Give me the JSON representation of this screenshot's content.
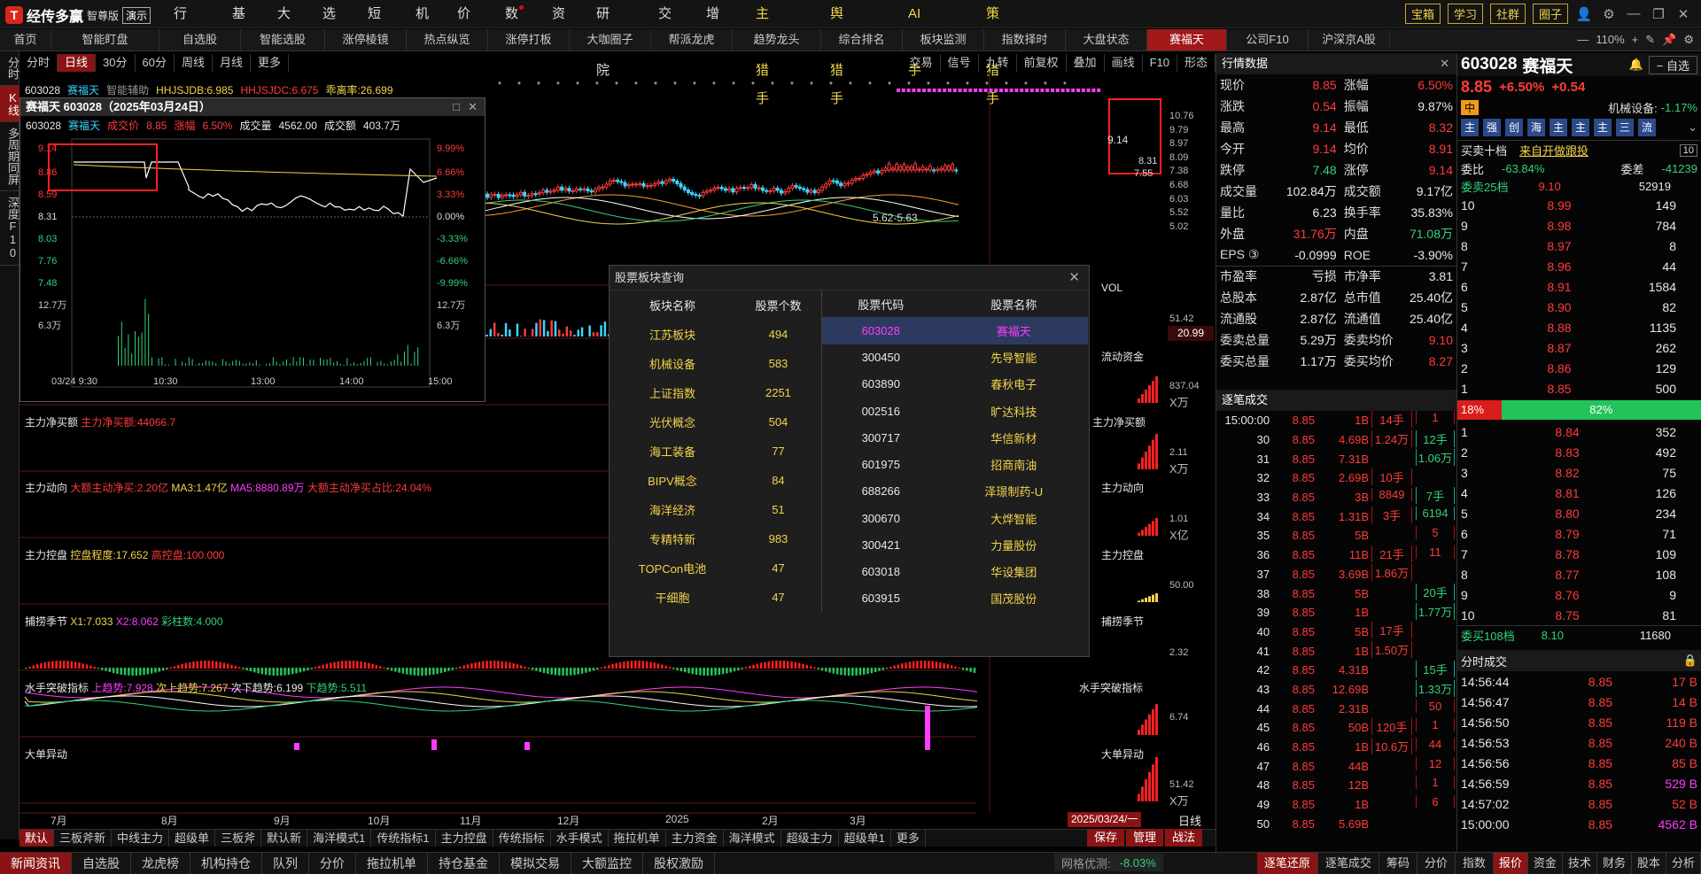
{
  "app": {
    "name": "经传多赢",
    "edition": "智尊版",
    "demo": "演示"
  },
  "menu": [
    {
      "label": "行情",
      "hl": false
    },
    {
      "label": "基金",
      "hl": false
    },
    {
      "label": "大盘",
      "hl": false
    },
    {
      "label": "选股",
      "hl": false
    },
    {
      "label": "短打",
      "hl": false
    },
    {
      "label": "机构",
      "hl": false
    },
    {
      "label": "价投",
      "hl": false
    },
    {
      "label": "数据",
      "hl": false,
      "dot": true
    },
    {
      "label": "资讯",
      "hl": false
    },
    {
      "label": "研究院",
      "hl": false
    },
    {
      "label": "交易",
      "hl": false
    },
    {
      "label": "增值",
      "hl": false
    },
    {
      "label": "主题猎手",
      "hl": true
    },
    {
      "label": "舆情猎手",
      "hl": true
    },
    {
      "label": "AI猎手",
      "hl": true
    },
    {
      "label": "策略猎手",
      "hl": true
    }
  ],
  "topright": [
    "宝箱",
    "学习",
    "社群",
    "圈子"
  ],
  "tabs": [
    "首页",
    "智能盯盘",
    "自选股",
    "智能选股",
    "涨停棱镜",
    "热点纵览",
    "涨停打板",
    "大咖圈子",
    "帮派龙虎",
    "趋势龙头",
    "综合排名",
    "板块监测",
    "指数择时",
    "大盘状态",
    "赛福天",
    "公司F10",
    "沪深京A股"
  ],
  "active_tab": "赛福天",
  "zoom": "110%",
  "vtabs": [
    "分时",
    "K线",
    "多周期同屏",
    "深度F10"
  ],
  "active_vtab": "K线",
  "chart_toolbar": [
    "分时",
    "日线",
    "30分",
    "60分",
    "周线",
    "月线",
    "更多"
  ],
  "chart_toolbar_active": "日线",
  "chart_toolbar_right": [
    "交易",
    "信号",
    "九转",
    "前复权",
    "叠加",
    "画线",
    "F10",
    "形态"
  ],
  "main": {
    "code": "603028",
    "name": "赛福天",
    "indicator": "智能辅助",
    "hhjsjdb": "HHJSJDB:6.985",
    "hhjsjdc": "HHJSJDC:6.675",
    "ratio": "乖离率:26.699",
    "price_axis": [
      "10.76",
      "9.79",
      "8.97",
      "8.09",
      "7.38",
      "6.68",
      "6.03",
      "5.52",
      "5.02"
    ],
    "high_label": "9.14",
    "low_label": "5.62-5.63",
    "last_label": "8.31",
    "mid_label": "7.55",
    "vol_label": "VOL",
    "vol_axis": [
      "51.42"
    ],
    "current_price": "20.99",
    "panels": [
      {
        "name": "流动资金",
        "axis": "837.04",
        "unit": "X万"
      },
      {
        "name": "主力净买额",
        "label": "主力净买额:44066.7",
        "axis": "2.11",
        "unit": "X万"
      },
      {
        "name": "主力动向",
        "l1": "大额主动净买:2.20亿",
        "l2": "MA3:1.47亿",
        "l3": "MA5:8880.89万",
        "l4": "大额主动净买占比:24.04%",
        "axis": "1.01",
        "unit": "X亿"
      },
      {
        "name": "主力控盘",
        "l1": "控盘程度:17.652",
        "l2": "高控盘:100.000",
        "axis": "50.00"
      },
      {
        "name": "捕捞季节",
        "l1": "X1:7.033",
        "l2": "X2:8.062",
        "l3": "彩柱数:4.000",
        "axis": "2.32"
      },
      {
        "name": "水手突破指标",
        "l1": "上趋势:7.928",
        "l2": "次上趋势:7.267",
        "l3": "次下趋势:6.199",
        "l4": "下趋势:5.511",
        "axis": "6.74"
      },
      {
        "name": "大单异动",
        "axis": "51.42",
        "unit": "X万"
      }
    ],
    "months": [
      "7月",
      "8月",
      "9月",
      "10月",
      "11月",
      "12月",
      "2025",
      "2月",
      "3月"
    ],
    "date_sel": "2025/03/24/一",
    "period": "日线"
  },
  "mini": {
    "title": "赛福天 603028（2025年03月24日）",
    "code": "603028",
    "name": "赛福天",
    "price_lbl": "成交价",
    "price": "8.85",
    "chg_lbl": "涨幅",
    "chg": "6.50%",
    "vol_lbl": "成交量",
    "vol": "4562.00",
    "amt_lbl": "成交额",
    "amt": "403.7万",
    "left_axis": [
      "9.14",
      "8.86",
      "8.59",
      "8.31",
      "8.03",
      "7.76",
      "7.48",
      "12.7万",
      "6.3万"
    ],
    "right_axis": [
      "9.99%",
      "6.66%",
      "3.33%",
      "0.00%",
      "-3.33%",
      "-6.66%",
      "-9.99%",
      "12.7万",
      "6.3万"
    ],
    "times": [
      "03/24 9:30",
      "10:30",
      "13:00",
      "14:00",
      "15:00"
    ]
  },
  "dlg": {
    "title": "股票板块查询",
    "h1": "板块名称",
    "h2": "股票个数",
    "h3": "股票代码",
    "h4": "股票名称",
    "boards": [
      [
        "江苏板块",
        "494"
      ],
      [
        "机械设备",
        "583"
      ],
      [
        "上证指数",
        "2251"
      ],
      [
        "光伏概念",
        "504"
      ],
      [
        "海工装备",
        "77"
      ],
      [
        "BIPV概念",
        "84"
      ],
      [
        "海洋经济",
        "51"
      ],
      [
        "专精特新",
        "983"
      ],
      [
        "TOPCon电池",
        "47"
      ],
      [
        "干细胞",
        "47"
      ]
    ],
    "stocks": [
      [
        "603028",
        "赛福天"
      ],
      [
        "300450",
        "先导智能"
      ],
      [
        "603890",
        "春秋电子"
      ],
      [
        "002516",
        "旷达科技"
      ],
      [
        "300717",
        "华信新材"
      ],
      [
        "601975",
        "招商南油"
      ],
      [
        "688266",
        "泽璟制药-U"
      ],
      [
        "300670",
        "大烨智能"
      ],
      [
        "300421",
        "力量股份"
      ],
      [
        "603018",
        "华设集团"
      ],
      [
        "603915",
        "国茂股份"
      ]
    ]
  },
  "quote": {
    "title": "行情数据",
    "rows": [
      [
        "现价",
        "8.85",
        "red",
        "涨幅",
        "6.50%",
        "red"
      ],
      [
        "涨跌",
        "0.54",
        "red",
        "振幅",
        "9.87%",
        "wht"
      ],
      [
        "最高",
        "9.14",
        "red",
        "最低",
        "8.32",
        "red"
      ],
      [
        "今开",
        "9.14",
        "red",
        "均价",
        "8.91",
        "red"
      ],
      [
        "跌停",
        "7.48",
        "grn",
        "涨停",
        "9.14",
        "red"
      ],
      [
        "成交量",
        "102.84万",
        "wht",
        "成交额",
        "9.17亿",
        "wht"
      ],
      [
        "量比",
        "6.23",
        "wht",
        "换手率",
        "35.83%",
        "wht"
      ],
      [
        "外盘",
        "31.76万",
        "red",
        "内盘",
        "71.08万",
        "grn"
      ],
      [
        "EPS ③",
        "-0.0999",
        "wht",
        "ROE",
        "-3.90%",
        "wht"
      ],
      [
        "市盈率",
        "亏损",
        "wht",
        "市净率",
        "3.81",
        "wht"
      ],
      [
        "总股本",
        "2.87亿",
        "wht",
        "总市值",
        "25.40亿",
        "wht"
      ],
      [
        "流通股",
        "2.87亿",
        "wht",
        "流通值",
        "25.40亿",
        "wht"
      ],
      [
        "委卖总量",
        "5.29万",
        "wht",
        "委卖均价",
        "9.10",
        "red"
      ],
      [
        "委买总量",
        "1.17万",
        "wht",
        "委买均价",
        "8.27",
        "red"
      ]
    ]
  },
  "trades": {
    "title": "逐笔成交",
    "rows": [
      [
        "15:00:00",
        "8.85",
        "1B"
      ],
      [
        "30",
        "8.85",
        "4.69B"
      ],
      [
        "31",
        "8.85",
        "7.31B"
      ],
      [
        "32",
        "8.85",
        "2.69B"
      ],
      [
        "33",
        "8.85",
        "3B"
      ],
      [
        "34",
        "8.85",
        "1.31B"
      ],
      [
        "35",
        "8.85",
        "5B"
      ],
      [
        "36",
        "8.85",
        "11B"
      ],
      [
        "37",
        "8.85",
        "3.69B"
      ],
      [
        "38",
        "8.85",
        "5B"
      ],
      [
        "39",
        "8.85",
        "1B"
      ],
      [
        "40",
        "8.85",
        "5B"
      ],
      [
        "41",
        "8.85",
        "1B"
      ],
      [
        "42",
        "8.85",
        "4.31B"
      ],
      [
        "43",
        "8.85",
        "12.69B"
      ],
      [
        "44",
        "8.85",
        "2.31B"
      ],
      [
        "45",
        "8.85",
        "50B"
      ],
      [
        "46",
        "8.85",
        "1B"
      ],
      [
        "47",
        "8.85",
        "44B"
      ],
      [
        "48",
        "8.85",
        "12B"
      ],
      [
        "49",
        "8.85",
        "1B"
      ],
      [
        "50",
        "8.85",
        "5.69B"
      ]
    ],
    "groups": [
      "14手",
      "1.24万",
      "10手",
      "8849",
      "3手",
      "21手",
      "1.86万",
      "17手",
      "1.50万",
      "120手",
      "10.6万"
    ],
    "groups2": [
      "1",
      "12手",
      "1.06万",
      "7手",
      "6194",
      "5",
      "11",
      "20手",
      "1.77万",
      "15手",
      "1.33万",
      "50",
      "1",
      "44",
      "12",
      "1",
      "6"
    ]
  },
  "book": {
    "code": "603028",
    "name": "赛福天",
    "btn": "自选",
    "price": "8.85",
    "chg": "+6.50%",
    "diff": "+0.54",
    "badge": "中",
    "sector": "机械设备:",
    "sector_chg": "-1.17%",
    "tags": [
      "主",
      "强",
      "创",
      "海",
      "主",
      "主",
      "主",
      "三",
      "流"
    ],
    "pro_lbl": "买卖十档",
    "pro_link": "来自开做跟投",
    "pro_num": "10",
    "ratio_lbl": "委比",
    "ratio": "-63.84%",
    "diff_lbl": "委差",
    "diff_val": "-41239",
    "sell_lbl": "委卖25档",
    "sell_p": "9.10",
    "sell_v": "52919",
    "asks": [
      [
        "10",
        "8.99",
        "149"
      ],
      [
        "9",
        "8.98",
        "784"
      ],
      [
        "8",
        "8.97",
        "8"
      ],
      [
        "7",
        "8.96",
        "44"
      ],
      [
        "6",
        "8.91",
        "1584"
      ],
      [
        "5",
        "8.90",
        "82"
      ],
      [
        "4",
        "8.88",
        "1135"
      ],
      [
        "3",
        "8.87",
        "262"
      ],
      [
        "2",
        "8.86",
        "129"
      ],
      [
        "1",
        "8.85",
        "500"
      ]
    ],
    "bar_l": "18%",
    "bar_r": "82%",
    "bids": [
      [
        "1",
        "8.84",
        "352"
      ],
      [
        "2",
        "8.83",
        "492"
      ],
      [
        "3",
        "8.82",
        "75"
      ],
      [
        "4",
        "8.81",
        "126"
      ],
      [
        "5",
        "8.80",
        "234"
      ],
      [
        "6",
        "8.79",
        "71"
      ],
      [
        "7",
        "8.78",
        "109"
      ],
      [
        "8",
        "8.77",
        "108"
      ],
      [
        "9",
        "8.76",
        "9"
      ],
      [
        "10",
        "8.75",
        "81"
      ]
    ],
    "buy_lbl": "委买108档",
    "buy_p": "8.10",
    "buy_v": "11680",
    "fen_title": "分时成交",
    "fen": [
      [
        "14:56:44",
        "8.85",
        "17 B"
      ],
      [
        "14:56:47",
        "8.85",
        "14 B"
      ],
      [
        "14:56:50",
        "8.85",
        "119 B"
      ],
      [
        "14:56:53",
        "8.85",
        "240 B"
      ],
      [
        "14:56:56",
        "8.85",
        "85 B"
      ],
      [
        "14:56:59",
        "8.85",
        "529 B"
      ],
      [
        "14:57:02",
        "8.85",
        "52 B"
      ],
      [
        "15:00:00",
        "8.85",
        "4562 B"
      ]
    ]
  },
  "btm1": [
    "默认",
    "三板斧新",
    "中线主力",
    "超级单",
    "三板斧",
    "默认新",
    "海洋模式1",
    "传统指标1",
    "主力控盘",
    "传统指标",
    "水手模式",
    "拖拉机单",
    "主力资金",
    "海洋模式",
    "超级主力",
    "超级单1",
    "更多"
  ],
  "btm1_right": [
    "保存",
    "管理",
    "战法"
  ],
  "btm2": [
    "新闻资讯",
    "自选股",
    "龙虎榜",
    "机构持仓",
    "队列",
    "分价",
    "拖拉机单",
    "持仓基金",
    "模拟交易",
    "大额监控",
    "股权激励"
  ],
  "btm2_right": [
    "逐笔还原",
    "逐笔成交",
    "筹码",
    "分价",
    "指数"
  ],
  "btm2_far": [
    "报价",
    "资金",
    "技术",
    "财务",
    "股本",
    "分析"
  ],
  "net_lbl": "网格优测:",
  "net_val": "-8.03%"
}
